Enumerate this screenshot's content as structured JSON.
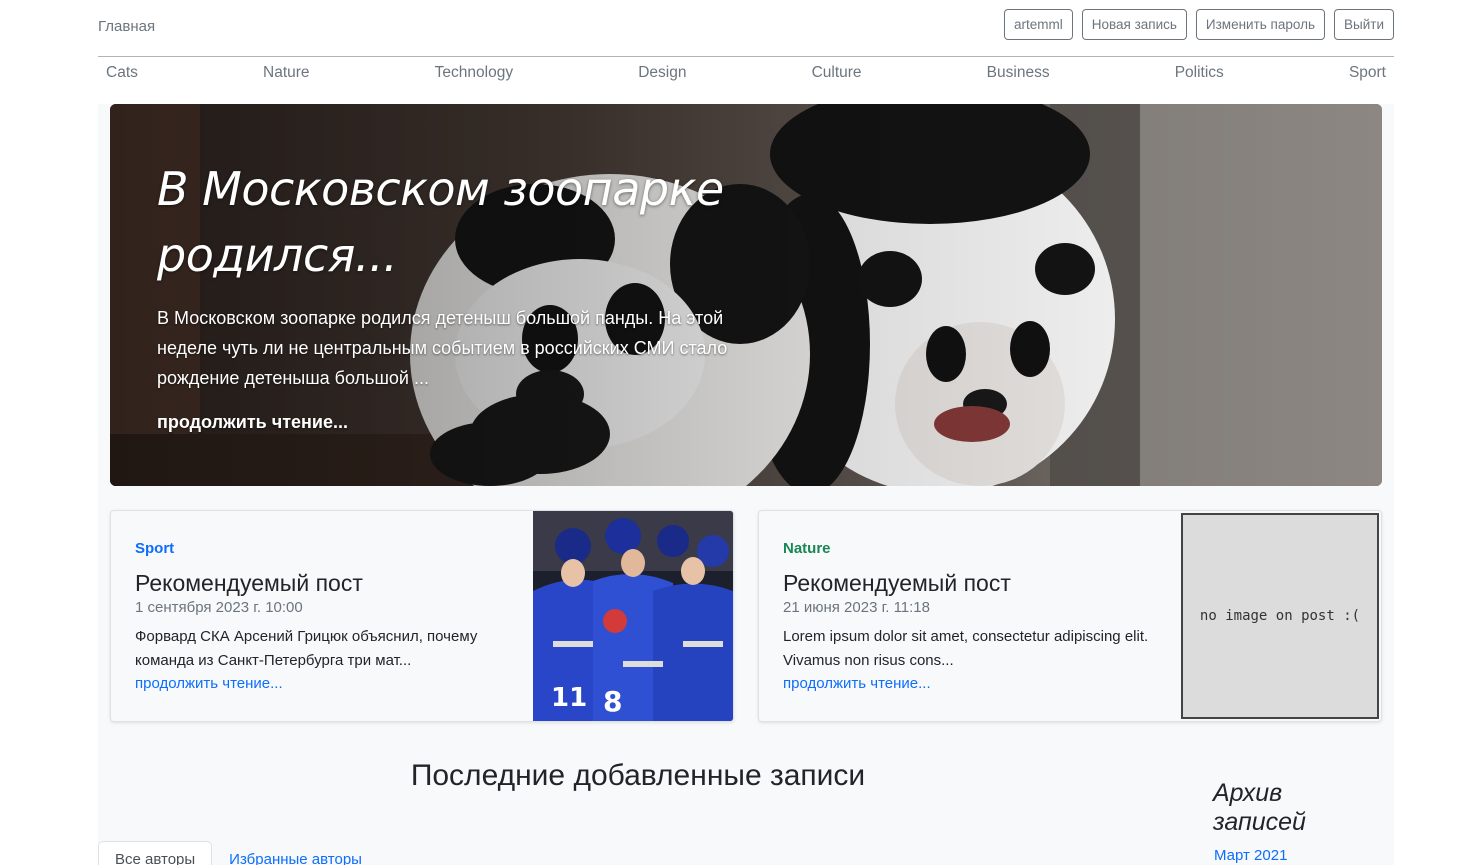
{
  "header": {
    "home_label": "Главная",
    "buttons": [
      {
        "label": "artemml"
      },
      {
        "label": "Новая запись"
      },
      {
        "label": "Изменить пароль"
      },
      {
        "label": "Выйти"
      }
    ]
  },
  "categories": [
    "Cats",
    "Nature",
    "Technology",
    "Design",
    "Culture",
    "Business",
    "Politics",
    "Sport"
  ],
  "hero": {
    "title": "В Московском зоопарке родился...",
    "excerpt": "В Московском зоопарке родился детеныш большой панды. На этой неделе чуть ли не центральным событием в российских СМИ стало рождение детеныша большой ...",
    "more_label": "продолжить чтение..."
  },
  "featured": [
    {
      "category": "Sport",
      "category_color": "#0d6efd",
      "title": "Рекомендуемый пост",
      "date": "1 сентября 2023 г. 10:00",
      "excerpt": "Форвард СКА Арсений Грицюк объяснил, почему команда из Санкт-Петербурга три мат...",
      "more_label": "продолжить чтение..."
    },
    {
      "category": "Nature",
      "category_color": "#198754",
      "title": "Рекомендуемый пост",
      "date": "21 июня 2023 г. 11:18",
      "excerpt": "Lorem ipsum dolor sit amet, consectetur adipiscing elit. Vivamus non risus cons...",
      "more_label": "продолжить чтение...",
      "no_image_text": "no image on post :("
    }
  ],
  "latest": {
    "heading": "Последние добавленные записи",
    "tabs": [
      {
        "label": "Все авторы",
        "active": true
      },
      {
        "label": "Избранные авторы",
        "active": false
      }
    ]
  },
  "archive": {
    "heading": "Архив записей",
    "items": [
      "Март 2021"
    ]
  },
  "colors": {
    "link": "#0d6efd",
    "muted": "#6c757d",
    "sport": "#0d6efd",
    "nature": "#198754"
  }
}
